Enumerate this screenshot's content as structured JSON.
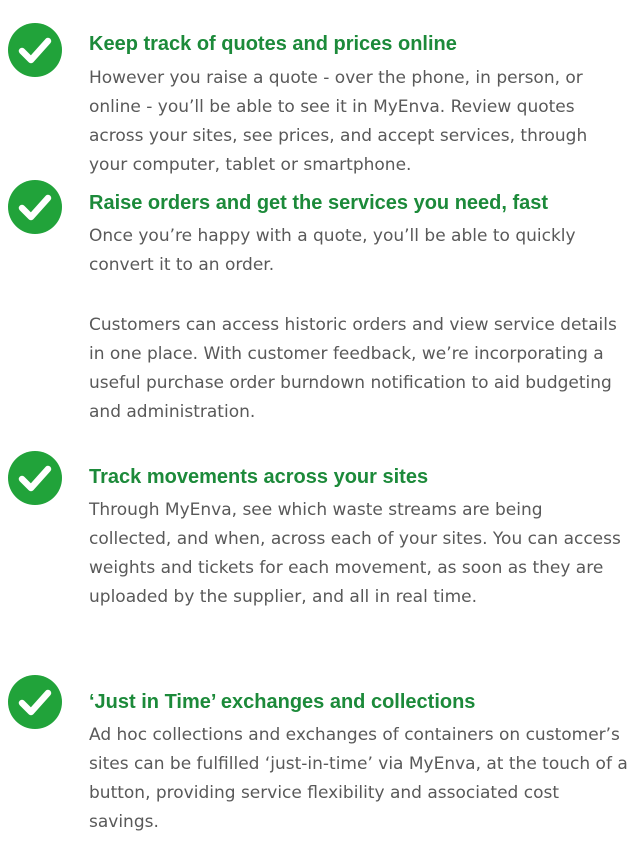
{
  "colors": {
    "accent_green": "#1c8a3a",
    "check_green": "#21a33a",
    "body_text": "#595959"
  },
  "icon": "check-circle-icon",
  "features": [
    {
      "title": "Keep track of quotes and prices online",
      "paragraphs": [
        "However you raise a quote - over the phone, in person, or online - you’ll be able to see it in MyEnva. Review quotes across your sites, see prices, and accept services, through your computer, tablet or smartphone."
      ]
    },
    {
      "title": "Raise orders and get the services you need, fast",
      "paragraphs": [
        "Once you’re happy with a quote, you’ll be able to quickly convert it to an order.",
        "Customers can access historic orders and view service details in one place. With customer feedback, we’re incorporating a useful purchase order burndown notification to aid budgeting and administration."
      ]
    },
    {
      "title": "Track movements across your sites",
      "paragraphs": [
        "Through MyEnva, see which waste streams are being collected, and when, across each of your sites. You can access weights and tickets for each movement, as soon as they are uploaded by the supplier, and all in real time."
      ]
    },
    {
      "title": "‘Just in Time’ exchanges and collections",
      "paragraphs": [
        "Ad hoc collections and exchanges of containers on customer’s sites can be fulfilled ‘just-in-time’ via MyEnva, at the touch of a button, providing service flexibility and associated cost savings."
      ]
    }
  ]
}
